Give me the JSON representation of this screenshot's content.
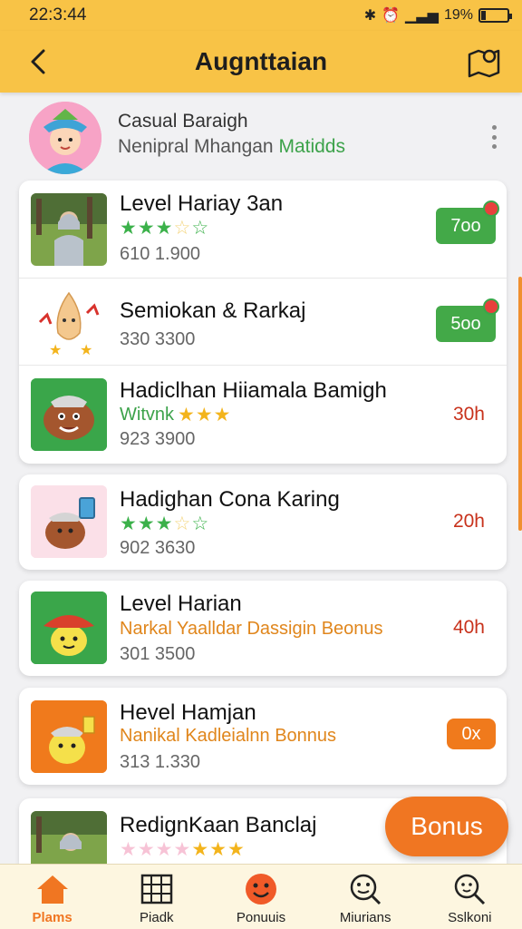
{
  "status": {
    "time": "22:3:44",
    "battery": "19%",
    "battery_level": 0.19
  },
  "appbar": {
    "title": "Augnttaian"
  },
  "profile": {
    "name": "Casual Baraigh",
    "sub_main": "Nenipral Mhangan",
    "sub_accent": "Matidds"
  },
  "card1": [
    {
      "title": "Level Hariay 3an",
      "meta": "610 1.900",
      "badge": "7oo",
      "rating": "3.5 of 5 stars"
    },
    {
      "title": "Semiokan & Rarkaj",
      "meta": "330 3300",
      "badge": "5oo"
    },
    {
      "title": "Hadiclhan Hiiamala Bamigh",
      "sub": "Witvnk",
      "meta": "923 3900",
      "right": "30h",
      "rating": "3 stars"
    }
  ],
  "card2": {
    "title": "Hadighan Cona Karing",
    "meta": "902 3630",
    "right": "20h",
    "rating": "3.5 of 5 stars"
  },
  "card3": {
    "title": "Level Harian",
    "sub": "Narkal Yaalldar Dassigin Beonus",
    "meta": "301 3500",
    "right": "40h"
  },
  "card4": {
    "title": "Hevel Hamjan",
    "sub": "Nanikal Kadleialnn Bonnus",
    "meta": "313 1.330",
    "badge": "0x"
  },
  "card5": {
    "title": "RedignKaan Banclaj",
    "rating": "3 gold stars"
  },
  "fab": {
    "label": "Bonus"
  },
  "nav": [
    {
      "label": "Plams",
      "icon": "home-icon",
      "active": true
    },
    {
      "label": "Piadk",
      "icon": "grid-icon",
      "active": false
    },
    {
      "label": "Ponuuis",
      "icon": "smiley-icon",
      "active": false
    },
    {
      "label": "Miurians",
      "icon": "face-search-icon",
      "active": false
    },
    {
      "label": "Sslkoni",
      "icon": "search-icon",
      "active": false
    }
  ],
  "colors": {
    "primary": "#f8c346",
    "accent": "#f07622",
    "green": "#43a948",
    "hours": "#c8321c"
  }
}
